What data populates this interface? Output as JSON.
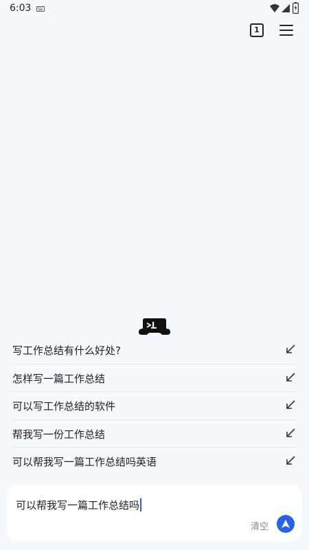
{
  "status_bar": {
    "time": "6:03",
    "icons": [
      "keyboard-icon",
      "wifi-icon",
      "signal-icon",
      "battery-charging-icon"
    ]
  },
  "top_bar": {
    "tab_count": "1",
    "icons": [
      "tabs-icon",
      "menu-icon"
    ]
  },
  "suggestions": [
    {
      "text": "写工作总结有什么好处?",
      "icon": "fill-arrow-icon"
    },
    {
      "text": "怎样写一篇工作总结",
      "icon": "fill-arrow-icon"
    },
    {
      "text": "可以写工作总结的软件",
      "icon": "fill-arrow-icon"
    },
    {
      "text": "帮我写一份工作总结",
      "icon": "fill-arrow-icon"
    },
    {
      "text": "可以帮我写一篇工作总结吗英语",
      "icon": "fill-arrow-icon"
    }
  ],
  "input": {
    "value": "可以帮我写一篇工作总结吗",
    "clear_label": "清空",
    "send_icon": "send-arrow-icon"
  },
  "colors": {
    "background": "#f5f8fc",
    "accent": "#2663e8",
    "card": "#ffffff"
  }
}
